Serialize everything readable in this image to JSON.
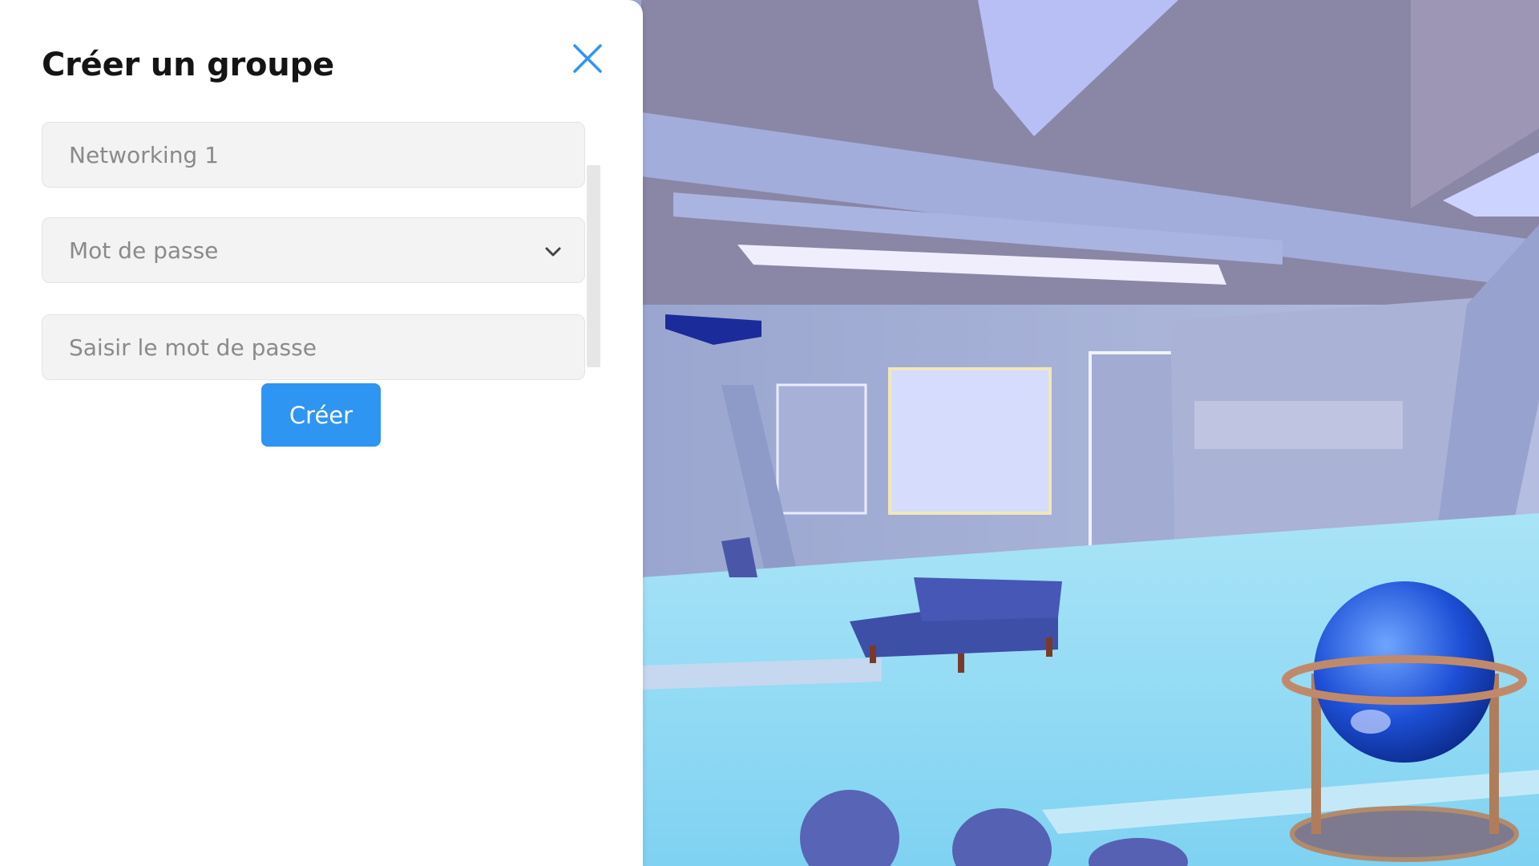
{
  "panel": {
    "title": "Créer un groupe",
    "close_icon": "close-icon",
    "group_name": {
      "value": "",
      "placeholder": "Networking 1"
    },
    "access_select": {
      "value": "Mot de passe",
      "icon": "chevron-down-icon"
    },
    "password_input": {
      "value": "",
      "placeholder": "Saisir le mot de passe"
    },
    "submit_label": "Créer"
  },
  "colors": {
    "accent": "#2f95f2",
    "panel_bg": "#ffffff",
    "field_bg": "#f3f3f3"
  }
}
